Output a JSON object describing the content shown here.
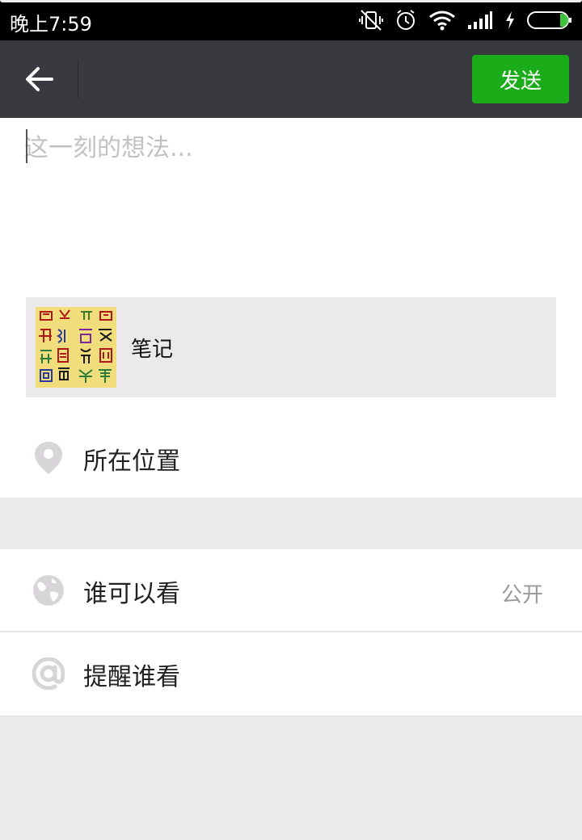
{
  "status_bar": {
    "time": "晚上7:59",
    "icons": [
      "vibrate-off-icon",
      "alarm-icon",
      "wifi-icon",
      "signal-icon",
      "charging-icon",
      "battery-icon"
    ]
  },
  "nav": {
    "back_icon": "arrow-left-icon",
    "send_label": "发送",
    "send_color": "#1aad19",
    "bar_color": "#393a3f"
  },
  "compose": {
    "placeholder": "这一刻的想法...",
    "value": ""
  },
  "share_card": {
    "title": "笔记",
    "thumbnail": "calligraphy-seal-thumbnail"
  },
  "rows": {
    "location": {
      "label": "所在位置",
      "icon": "location-pin-icon"
    },
    "visibility": {
      "label": "谁可以看",
      "value": "公开",
      "icon": "globe-icon"
    },
    "remind": {
      "label": "提醒谁看",
      "icon": "at-icon"
    }
  }
}
